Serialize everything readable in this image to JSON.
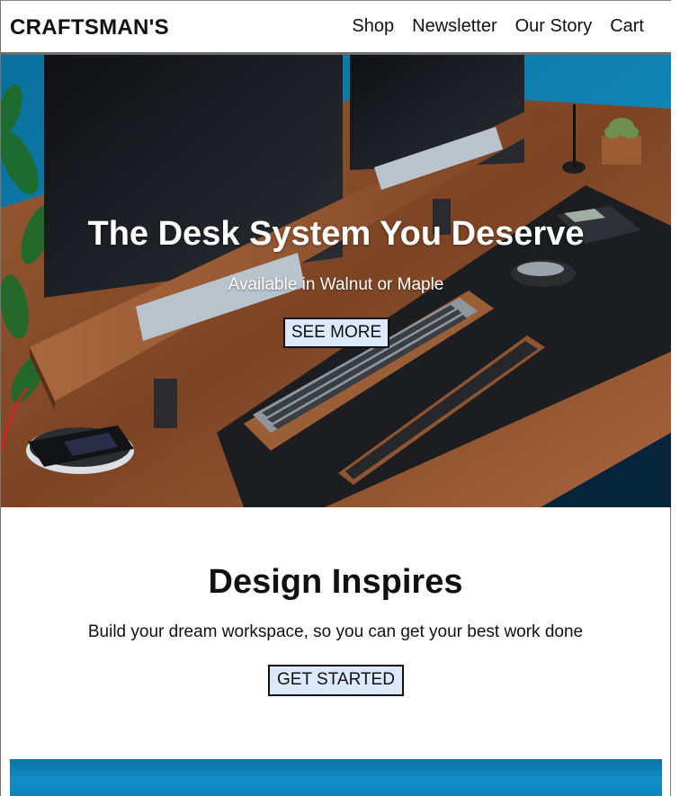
{
  "header": {
    "brand": "CRAFTSMAN'S",
    "nav": [
      "Shop",
      "Newsletter",
      "Our Story",
      "Cart"
    ]
  },
  "hero": {
    "title": "The Desk System You Deserve",
    "subtitle": "Available in Walnut or Maple",
    "button_label": "SEE MORE"
  },
  "section": {
    "title": "Design Inspires",
    "subtitle": "Build your dream workspace, so you can get your best work done",
    "button_label": "GET STARTED"
  },
  "colors": {
    "button_bg": "#dbe9fb",
    "hero_wall": "#0c7fa8",
    "desk_walnut": "#8a4f2c"
  }
}
